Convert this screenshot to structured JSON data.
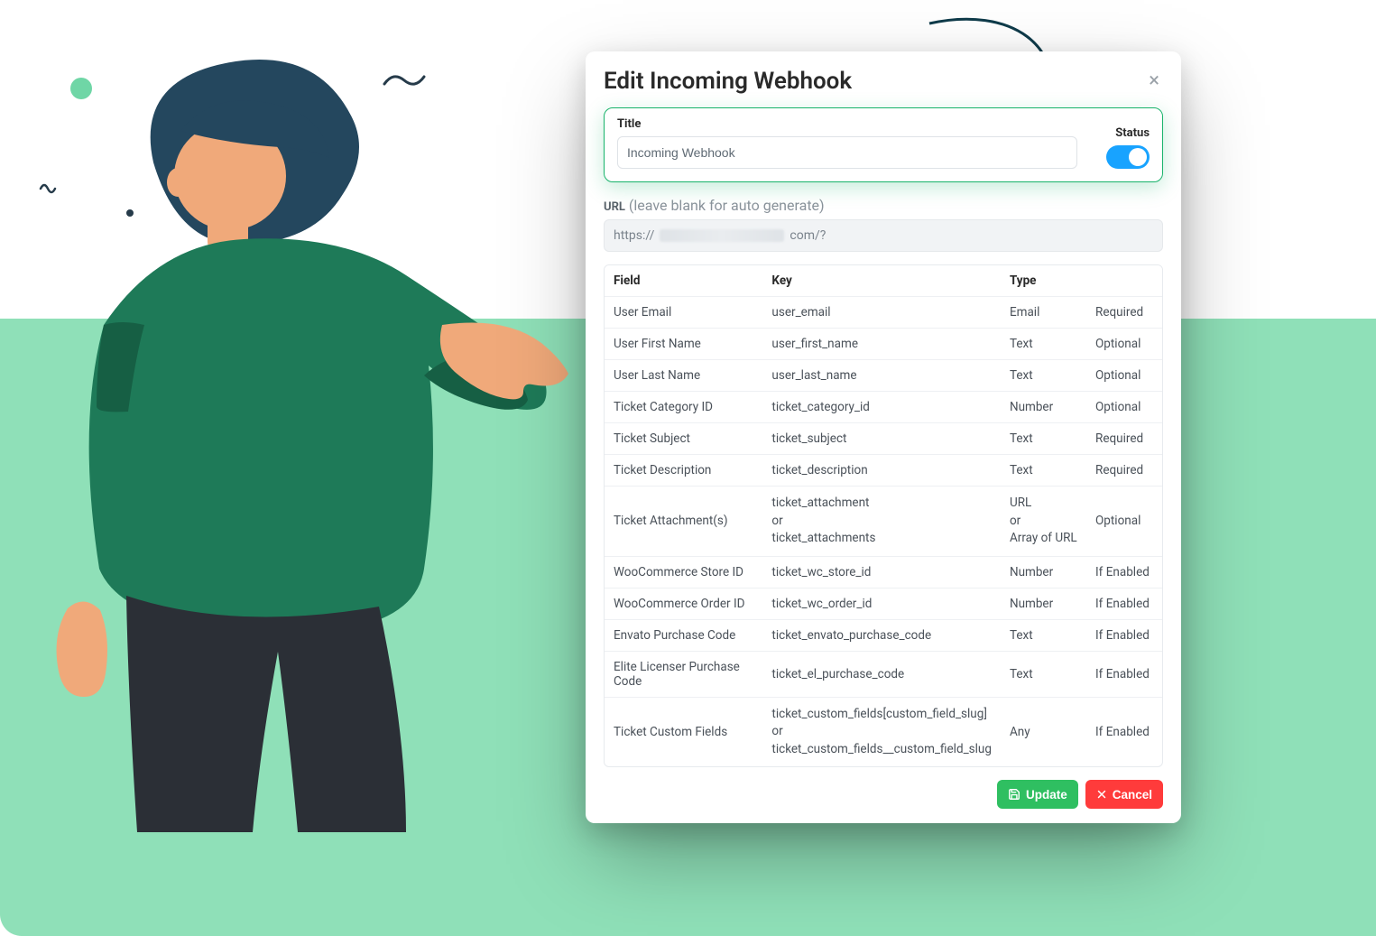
{
  "modal": {
    "heading": "Edit Incoming Webhook",
    "close_symbol": "×",
    "title_label": "Title",
    "title_value": "Incoming Webhook",
    "status_label": "Status",
    "status_on": true,
    "url_label": "URL",
    "url_hint": "(leave blank for auto generate)",
    "url_prefix": "https://",
    "url_suffix": "com/?"
  },
  "table": {
    "headers": {
      "field": "Field",
      "key": "Key",
      "type": "Type",
      "req": ""
    },
    "rows": [
      {
        "field": "User Email",
        "key": "user_email",
        "type": "Email",
        "req": "Required"
      },
      {
        "field": "User First Name",
        "key": "user_first_name",
        "type": "Text",
        "req": "Optional"
      },
      {
        "field": "User Last Name",
        "key": "user_last_name",
        "type": "Text",
        "req": "Optional"
      },
      {
        "field": "Ticket Category ID",
        "key": "ticket_category_id",
        "type": "Number",
        "req": "Optional"
      },
      {
        "field": "Ticket Subject",
        "key": "ticket_subject",
        "type": "Text",
        "req": "Required"
      },
      {
        "field": "Ticket Description",
        "key": "ticket_description",
        "type": "Text",
        "req": "Required"
      },
      {
        "field": "Ticket Attachment(s)",
        "key": "ticket_attachment\nor\nticket_attachments",
        "type": "URL\nor\nArray of URL",
        "req": "Optional"
      },
      {
        "field": "WooCommerce Store ID",
        "key": "ticket_wc_store_id",
        "type": "Number",
        "req": "If Enabled"
      },
      {
        "field": "WooCommerce Order ID",
        "key": "ticket_wc_order_id",
        "type": "Number",
        "req": "If Enabled"
      },
      {
        "field": "Envato Purchase Code",
        "key": "ticket_envato_purchase_code",
        "type": "Text",
        "req": "If Enabled"
      },
      {
        "field": "Elite Licenser Purchase Code",
        "key": "ticket_el_purchase_code",
        "type": "Text",
        "req": "If Enabled"
      },
      {
        "field": "Ticket Custom Fields",
        "key": "ticket_custom_fields[custom_field_slug]\nor\nticket_custom_fields__custom_field_slug",
        "type": "Any",
        "req": "If Enabled"
      }
    ]
  },
  "actions": {
    "update_label": "Update",
    "cancel_label": "Cancel"
  },
  "colors": {
    "accent_green": "#19b36b",
    "button_green": "#2fbf61",
    "button_red": "#ff3b3b",
    "toggle_blue": "#18a3ff",
    "band_green": "#8fe0b8"
  }
}
